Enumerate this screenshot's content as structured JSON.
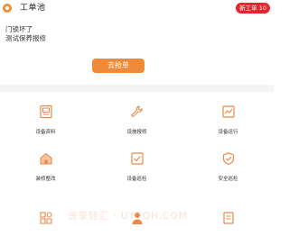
{
  "header": {
    "title": "工单池",
    "badge": "新工单 10"
  },
  "order": {
    "line1": "门锁坏了",
    "line2": "测试保养报修"
  },
  "action": {
    "grab_label": "去抢单"
  },
  "grid": {
    "items": [
      {
        "label": "设备资料",
        "icon": "device-info-icon"
      },
      {
        "label": "设施报修",
        "icon": "wrench-icon"
      },
      {
        "label": "设备运行",
        "icon": "chart-icon"
      },
      {
        "label": "装修整改",
        "icon": "house-icon"
      },
      {
        "label": "设备巡检",
        "icon": "check-box-icon"
      },
      {
        "label": "安全巡检",
        "icon": "shield-icon"
      },
      {
        "label": "",
        "icon": "apps-icon"
      },
      {
        "label": "",
        "icon": "person-icon"
      },
      {
        "label": "",
        "icon": "doc-icon"
      }
    ]
  },
  "watermark": "资享轻汇 · UYCQH.COM",
  "colors": {
    "accent": "#ef8a3a",
    "badge": "#e8242f",
    "icon": "#e8894a"
  }
}
